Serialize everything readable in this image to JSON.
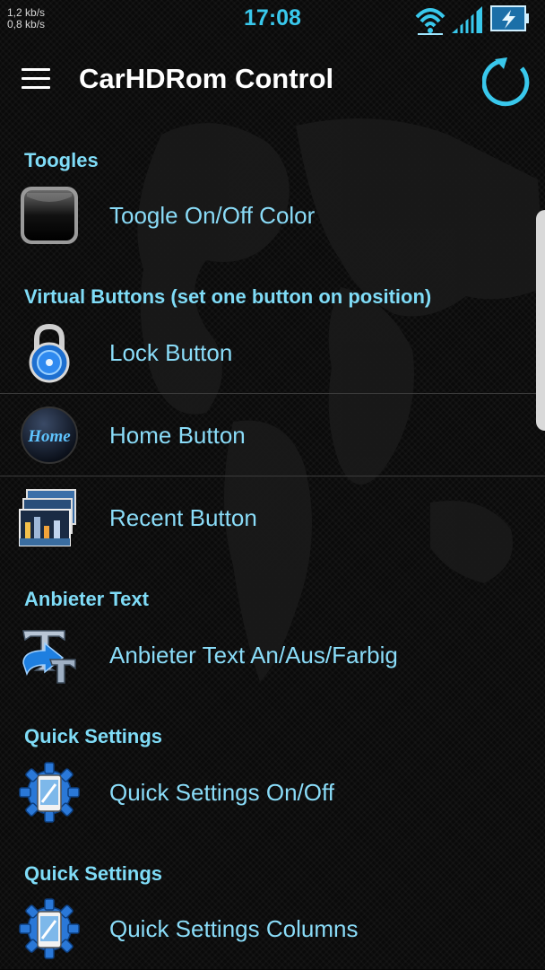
{
  "status": {
    "net_up": "1,2 kb/s",
    "net_down": "0,8 kb/s",
    "time": "17:08",
    "icons": [
      "wifi-icon",
      "signal-icon",
      "battery-charging-icon"
    ]
  },
  "appbar": {
    "title": "CarHDRom Control",
    "menu_icon": "menu-icon",
    "refresh_icon": "refresh-icon"
  },
  "colors": {
    "accent": "#39c8ec",
    "section_header": "#7fdcf7",
    "item_text": "#8adcf8",
    "background": "#070707"
  },
  "sections": [
    {
      "header": "Toogles",
      "items": [
        {
          "label": "Toogle On/Off Color",
          "icon": "toggle-button-icon"
        }
      ]
    },
    {
      "header": "Virtual Buttons (set one button on position)",
      "items": [
        {
          "label": "Lock Button",
          "icon": "padlock-icon"
        },
        {
          "label": "Home Button",
          "icon": "home-button-icon",
          "icon_text": "Home"
        },
        {
          "label": "Recent Button",
          "icon": "recent-apps-icon"
        }
      ]
    },
    {
      "header": "Anbieter Text",
      "items": [
        {
          "label": "Anbieter Text An/Aus/Farbig",
          "icon": "text-arrow-icon"
        }
      ]
    },
    {
      "header": "Quick Settings",
      "items": [
        {
          "label": "Quick Settings On/Off",
          "icon": "settings-gear-phone-icon"
        }
      ]
    },
    {
      "header": "Quick Settings",
      "items": [
        {
          "label": "Quick Settings Columns",
          "icon": "settings-gear-phone-icon"
        }
      ]
    }
  ]
}
